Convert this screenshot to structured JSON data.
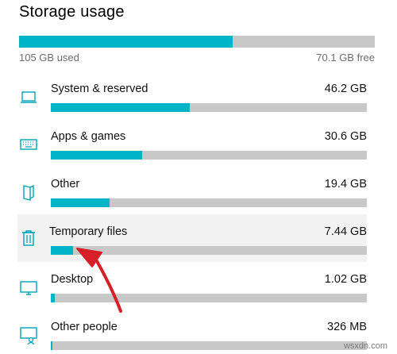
{
  "title": "Storage usage",
  "total": {
    "used_label": "105 GB used",
    "free_label": "70.1 GB free",
    "used_fraction": 0.6
  },
  "items": [
    {
      "name": "System & reserved",
      "size": "46.2 GB",
      "fraction": 0.44,
      "icon": "laptop-icon"
    },
    {
      "name": "Apps & games",
      "size": "30.6 GB",
      "fraction": 0.29,
      "icon": "keyboard-icon"
    },
    {
      "name": "Other",
      "size": "19.4 GB",
      "fraction": 0.185,
      "icon": "documents-icon"
    },
    {
      "name": "Temporary files",
      "size": "7.44 GB",
      "fraction": 0.07,
      "icon": "trash-icon",
      "highlighted": true
    },
    {
      "name": "Desktop",
      "size": "1.02 GB",
      "fraction": 0.012,
      "icon": "monitor-icon"
    },
    {
      "name": "Other people",
      "size": "326 MB",
      "fraction": 0.005,
      "icon": "person-screen-icon"
    }
  ],
  "watermark": "wsxdn.com",
  "colors": {
    "accent": "#00b4c8",
    "track": "#c8c8c8",
    "highlight_bg": "#f2f2f2",
    "arrow": "#d61f26"
  }
}
